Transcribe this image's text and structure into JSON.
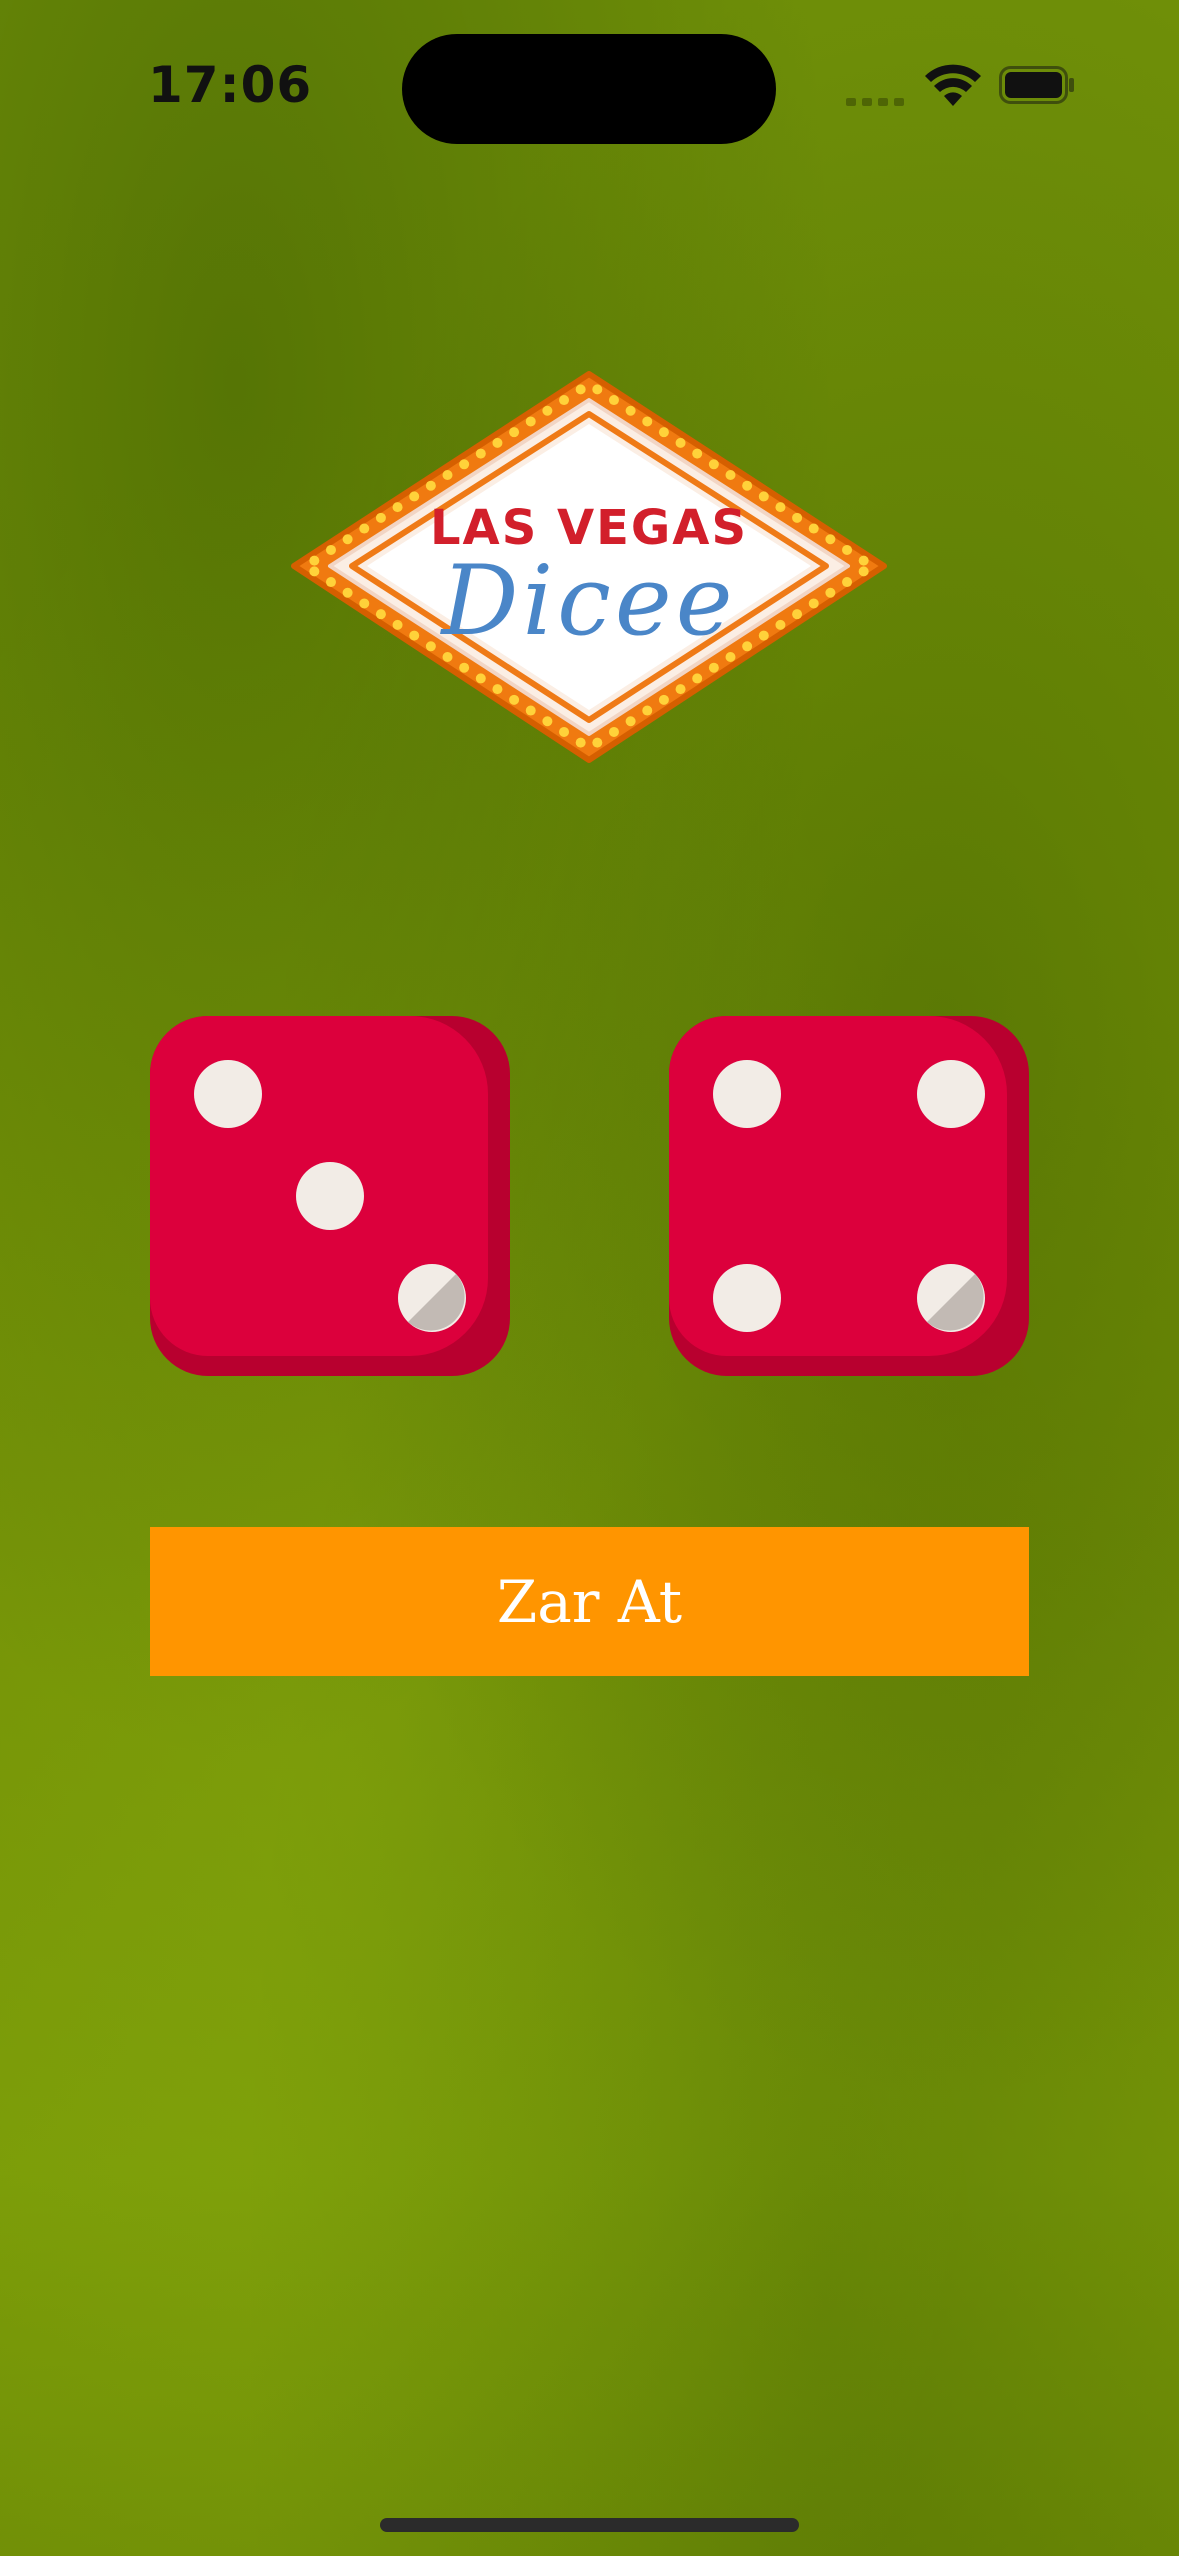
{
  "status_bar": {
    "time": "17:06"
  },
  "logo": {
    "line1": "LAS VEGAS",
    "line2": "Dicee",
    "colors": {
      "bulb_frame": "#f07a10",
      "bulb": "#ffd23a",
      "line1": "#d21f2b",
      "line2": "#4a86c8"
    }
  },
  "dice": {
    "left_value": 3,
    "right_value": 4,
    "colors": {
      "face": "#dc003c",
      "shadow": "#b8002f",
      "pip": "#f2ece6"
    }
  },
  "roll_button": {
    "label": "Zar At",
    "color": "#ff9500"
  },
  "icons": [
    "signal-icon",
    "wifi-icon",
    "battery-icon",
    "home-indicator"
  ]
}
